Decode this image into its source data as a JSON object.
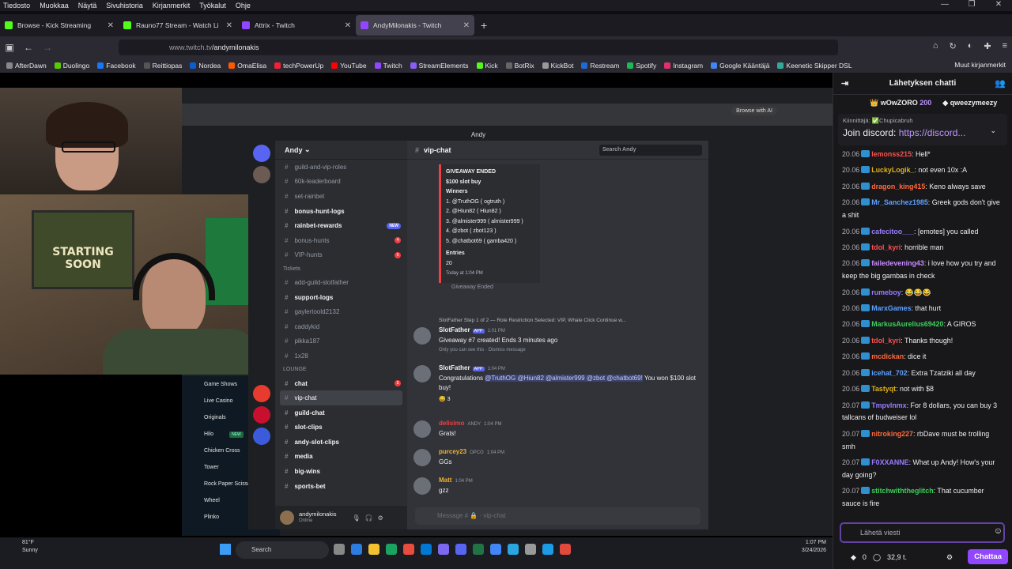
{
  "menubar": [
    "Tiedosto",
    "Muokkaa",
    "Näytä",
    "Sivuhistoria",
    "Kirjanmerkit",
    "Työkalut",
    "Ohje"
  ],
  "tabs": [
    {
      "label": "Browse - Kick Streaming",
      "color": "#53fc18"
    },
    {
      "label": "Rauno77 Stream - Watch Li",
      "color": "#53fc18"
    },
    {
      "label": "Attrix - Twitch",
      "color": "#9147ff"
    },
    {
      "label": "AndyMilonakis - Twitch",
      "color": "#9147ff"
    }
  ],
  "address": {
    "host": "www.twitch.tv",
    "path": "/andymilonakis"
  },
  "bookmarks": [
    "AfterDawn",
    "Duolingo",
    "Facebook",
    "Reittiopas",
    "Nordea",
    "OmaElisa",
    "techPowerUp",
    "YouTube",
    "Twitch",
    "StreamElements",
    "Kick",
    "BotRix",
    "KickBot",
    "Restream",
    "Spotify",
    "Instagram",
    "Google Kääntäjä",
    "Keenetic Skipper DSL"
  ],
  "bookmarks_other": "Muut kirjanmerkit",
  "inner": {
    "browse_ai": "Browse with AI",
    "poster_text": "STARTING SOON",
    "sitebar": [
      "Game Shows",
      "Live Casino",
      "Originals",
      "Hilo",
      "Chicken Cross",
      "Tower",
      "Rock Paper Scissors",
      "Wheel",
      "Plinko"
    ],
    "new": "NEW"
  },
  "discord": {
    "window_title": "Andy",
    "server": "Andy",
    "channel": "vip-chat",
    "search_placeholder": "Search Andy",
    "channels": [
      {
        "name": "guild-and-vip-roles",
        "style": "dim"
      },
      {
        "name": "60k-leaderboard",
        "style": "dim"
      },
      {
        "name": "set-rainbet",
        "style": "dim"
      },
      {
        "name": "bonus-hunt-logs",
        "style": "bright"
      },
      {
        "name": "rainbet-rewards",
        "style": "bright",
        "badge": "NEW"
      },
      {
        "name": "bonus-hunts",
        "style": "dim",
        "count": "4"
      },
      {
        "name": "VIP-hunts",
        "style": "dim",
        "count": "6"
      }
    ],
    "category_tickets": "Tickets",
    "channels2": [
      {
        "name": "add-guild-slotfather",
        "style": "dim"
      },
      {
        "name": "support-logs",
        "style": "bright"
      },
      {
        "name": "gaylertoold2132",
        "style": "dim"
      },
      {
        "name": "caddykid",
        "style": "dim"
      },
      {
        "name": "pikka187",
        "style": "dim"
      },
      {
        "name": "1x28",
        "style": "dim"
      }
    ],
    "category_lounge": "LOUNGE",
    "channels3": [
      {
        "name": "chat",
        "style": "bright",
        "count": "1"
      },
      {
        "name": "vip-chat",
        "style": "sel"
      },
      {
        "name": "guild-chat",
        "style": "bright"
      },
      {
        "name": "slot-clips",
        "style": "bright"
      },
      {
        "name": "andy-slot-clips",
        "style": "bright"
      },
      {
        "name": "media",
        "style": "bright"
      },
      {
        "name": "big-wins",
        "style": "bright"
      },
      {
        "name": "sports-bet",
        "style": "bright"
      }
    ],
    "user": {
      "name": "andymilonakis",
      "status": "Online"
    },
    "embed": {
      "heading": "GIVEAWAY ENDED",
      "prize": "$100 slot buy",
      "winners_label": "Winners",
      "winners": [
        "1. @TruthOG ( ogtruth )",
        "2. @Hiun82 ( Hiun82 )",
        "3. @almister999 ( almister999 )",
        "4. @zbot ( zbot123 )",
        "5. @chatbot69 ( gamba420 )"
      ],
      "entries_label": "Entries",
      "entries": "20",
      "footer": "Today at 1:04 PM",
      "ended": "Giveaway Ended"
    },
    "messages": [
      {
        "name": "SlotFather",
        "app": "APP",
        "time": "1:01 PM",
        "text": "Giveaway #7 created! Ends 3 minutes ago",
        "note": "Only you can see this · Dismiss message",
        "reply": "SlotFather Step 1 of 2 — Role Restriction Selected: VIP, Whale Click Continue w..."
      },
      {
        "name": "SlotFather",
        "app": "APP",
        "time": "1:04 PM",
        "text_pre": "Congratulations",
        "mentions": "@TruthOG @Hiun82 @almister999 @zbot @chatbot69!",
        "text_post": "You won $100 slot buy!",
        "reaction": "3"
      },
      {
        "name": "delisimo",
        "time": "1:04 PM",
        "tag": "ANDY",
        "text": "Grats!",
        "color": "#f23f43"
      },
      {
        "name": "purcey23",
        "time": "1:04 PM",
        "tag": "OPCG",
        "text": "GGs",
        "color": "#f0b232"
      },
      {
        "name": "Matt",
        "time": "1:04 PM",
        "text": "gzz",
        "color": "#f0b232"
      }
    ],
    "composer_placeholder": "Message # 🔒 · vip-chat"
  },
  "taskbar": {
    "search": "Search",
    "temp": "81°F",
    "weather": "Sunny",
    "time": "1:07 PM",
    "date": "3/24/2026"
  },
  "chat": {
    "title": "Lähetyksen chatti",
    "leaders": [
      {
        "name": "wOwZORO",
        "points": "200"
      },
      {
        "name": "qweezymeezy"
      }
    ],
    "pinned_by": "Kiinnittäjä: ✅Chupicabruh",
    "pinned_prefix": "Join discord: ",
    "pinned_link": "https://discord...",
    "lines": [
      {
        "t": "20.06",
        "u": "lemonss215",
        "c": "#ff4f4f",
        "m": ": Hell*"
      },
      {
        "t": "20.06",
        "u": "LuckyLogik_",
        "c": "#e0b21a",
        "m": ": not even 10x :A"
      },
      {
        "t": "20.06",
        "u": "dragon_king415",
        "c": "#ff6a3c",
        "m": ": Keno always save"
      },
      {
        "t": "20.06",
        "u": "Mr_Sanchez1985",
        "c": "#5fa0ff",
        "m": ": Greek gods don't give a shit"
      },
      {
        "t": "20.06",
        "u": "cafecitoo___",
        "c": "#9a7bff",
        "m": ": [emotes] you called"
      },
      {
        "t": "20.06",
        "u": "tdol_kyri",
        "c": "#ff4f4f",
        "m": ": horrible man"
      },
      {
        "t": "20.06",
        "u": "failedevening43",
        "c": "#c88bff",
        "m": ": i love how you try and keep the big gambas in check"
      },
      {
        "t": "20.06",
        "u": "rumeboy",
        "c": "#9a7bff",
        "m": ": 😂😂😂"
      },
      {
        "t": "20.06",
        "u": "MarxGames",
        "c": "#5fa0ff",
        "m": ": that hurt"
      },
      {
        "t": "20.06",
        "u": "MarkusAurelius69420",
        "c": "#3cd25a",
        "m": ": A GIROS"
      },
      {
        "t": "20.06",
        "u": "tdol_kyri",
        "c": "#ff4f4f",
        "m": ": Thanks though!"
      },
      {
        "t": "20.06",
        "u": "mcdickan",
        "c": "#ff6a3c",
        "m": ": dice it"
      },
      {
        "t": "20.06",
        "u": "icehat_702",
        "c": "#5fa0ff",
        "m": ": Extra Tzatziki all day"
      },
      {
        "t": "20.06",
        "u": "Tastyqt",
        "c": "#e0b21a",
        "m": ": not with $8"
      },
      {
        "t": "20.07",
        "u": "Tmpvlnmx",
        "c": "#9a7bff",
        "m": ": For 8 dollars, you can buy 3 tallcans of budweiser lol"
      },
      {
        "t": "20.07",
        "u": "nitroking227",
        "c": "#ff6a3c",
        "m": ": rbDave must be trolling smh"
      },
      {
        "t": "20.07",
        "u": "F0XXANNE",
        "c": "#9a7bff",
        "m": ": What up Andy! How's your day going?"
      },
      {
        "t": "20.07",
        "u": "stitchwiththeglitch",
        "c": "#3cd25a",
        "m": ": That cucumber sauce is fire"
      }
    ],
    "input_placeholder": "Lähetä viesti",
    "points": "0",
    "balance": "32,9 t.",
    "send": "Chattaa"
  }
}
